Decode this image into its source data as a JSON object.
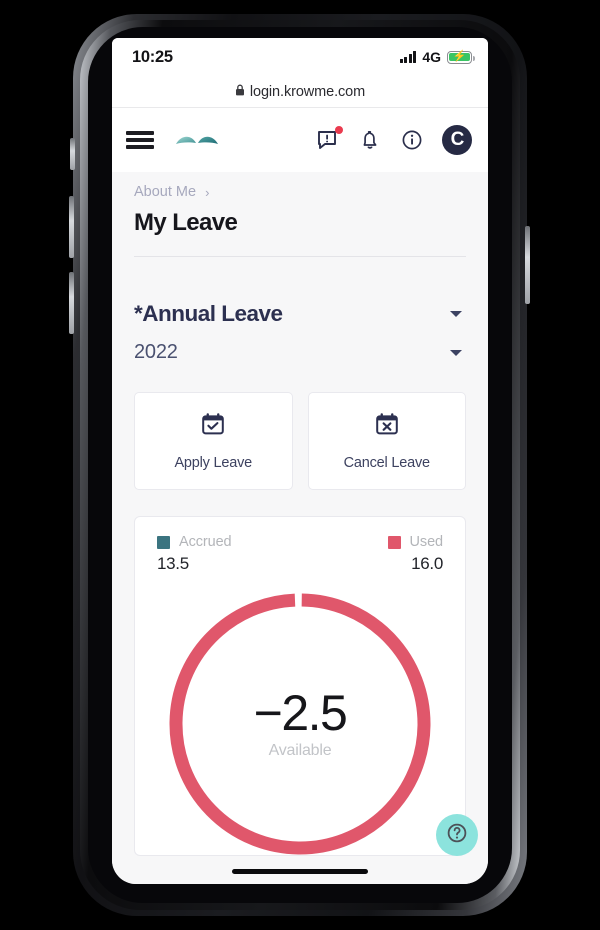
{
  "status_bar": {
    "time": "10:25",
    "network_type": "4G",
    "signal_icon": "signal-bars-icon",
    "battery_icon": "battery-charging-icon",
    "battery_bolt": "⚡"
  },
  "browser": {
    "lock_icon": "lock-icon",
    "url": "login.krowme.com"
  },
  "app_bar": {
    "menu_icon": "hamburger-menu-icon",
    "brand_logo": "krowme-wings-logo",
    "icons": [
      {
        "name": "feedback-message-icon",
        "badge": true
      },
      {
        "name": "notification-bell-icon",
        "badge": false
      },
      {
        "name": "info-circle-icon",
        "badge": false
      }
    ],
    "avatar_letter": "C",
    "avatar_icon": "user-avatar"
  },
  "breadcrumb": {
    "label": "About Me",
    "separator": "›"
  },
  "page": {
    "title": "My Leave"
  },
  "filters": {
    "leave_type": "*Annual Leave",
    "year": "2022",
    "caret_icon": "chevron-down-icon"
  },
  "actions": [
    {
      "label": "Apply Leave",
      "icon": "calendar-check-icon"
    },
    {
      "label": "Cancel Leave",
      "icon": "calendar-x-icon"
    }
  ],
  "colors": {
    "accrued": "#3b7480",
    "used": "#e0576b",
    "ring": "#e0576b",
    "fab": "#8ce3dd",
    "title": "#16161c",
    "muted": "#b3b5b9"
  },
  "fab": {
    "icon": "help-question-icon"
  },
  "chart_data": {
    "type": "pie",
    "title": "Leave balance",
    "slices": [
      {
        "label": "Accrued",
        "value": 13.5,
        "color": "#3b7480"
      },
      {
        "label": "Used",
        "value": 16.0,
        "color": "#e0576b"
      }
    ],
    "legend": [
      {
        "name": "Accrued",
        "value": "13.5",
        "color": "#3b7480"
      },
      {
        "name": "Used",
        "value": "16.0",
        "color": "#e0576b"
      }
    ],
    "center_value": "−2.5",
    "center_label": "Available",
    "donut": true,
    "ring_fraction": 1.0,
    "legend_position": "top",
    "grid": false
  }
}
